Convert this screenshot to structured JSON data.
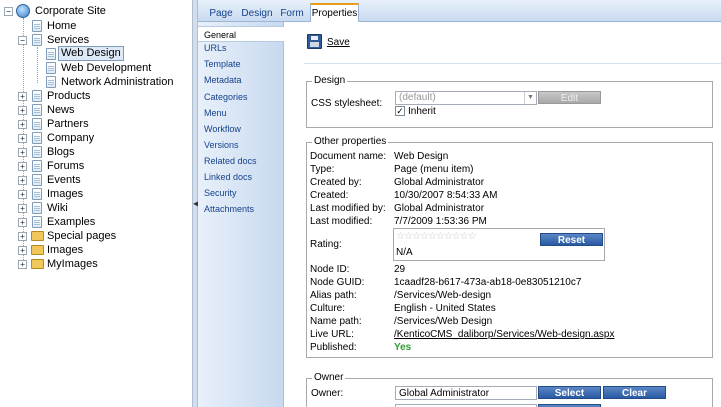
{
  "tree": {
    "root": "Corporate Site",
    "home": "Home",
    "services": "Services",
    "services_children": [
      "Web Design",
      "Web Development",
      "Network Administration"
    ],
    "items": [
      "Products",
      "News",
      "Partners",
      "Company",
      "Blogs",
      "Forums",
      "Events",
      "Images",
      "Wiki",
      "Examples"
    ],
    "folders": [
      "Special pages",
      "Images",
      "MyImages"
    ]
  },
  "tabs": [
    "Page",
    "Design",
    "Form",
    "Properties"
  ],
  "menu": [
    "General",
    "URLs",
    "Template",
    "Metadata",
    "Categories",
    "Menu",
    "Workflow",
    "Versions",
    "Related docs",
    "Linked docs",
    "Security",
    "Attachments"
  ],
  "toolbar": {
    "save_label": "Save"
  },
  "design": {
    "legend": "Design",
    "css_label": "CSS stylesheet:",
    "css_value": "(default)",
    "edit_label": "Edit",
    "inherit_label": "Inherit"
  },
  "other": {
    "legend": "Other properties",
    "rows": [
      {
        "label": "Document name:",
        "value": "Web Design"
      },
      {
        "label": "Type:",
        "value": "Page (menu item)"
      },
      {
        "label": "Created by:",
        "value": "Global Administrator"
      },
      {
        "label": "Created:",
        "value": "10/30/2007 8:54:33 AM"
      },
      {
        "label": "Last modified by:",
        "value": "Global Administrator"
      },
      {
        "label": "Last modified:",
        "value": "7/7/2009 1:53:36 PM"
      }
    ],
    "rating_label": "Rating:",
    "rating_value": "N/A",
    "rating_stars": 0,
    "reset_label": "Reset",
    "rows2": [
      {
        "label": "Node ID:",
        "value": "29"
      },
      {
        "label": "Node GUID:",
        "value": "1caadf28-b617-473a-ab18-0e83051210c7"
      },
      {
        "label": "Alias path:",
        "value": "/Services/Web-design"
      },
      {
        "label": "Culture:",
        "value": "English - United States"
      },
      {
        "label": "Name path:",
        "value": "/Services/Web Design"
      }
    ],
    "live_url_label": "Live URL:",
    "live_url": "/KenticoCMS_daliborp/Services/Web-design.aspx",
    "published_label": "Published:",
    "published_value": "Yes"
  },
  "owner": {
    "legend": "Owner",
    "label": "Owner:",
    "value": "Global Administrator",
    "select_label": "Select",
    "clear_label": "Clear"
  },
  "colors": {
    "accent": "#2a5aa3",
    "published": "#2e9e2e",
    "tab_highlight": "#e89d1b"
  }
}
